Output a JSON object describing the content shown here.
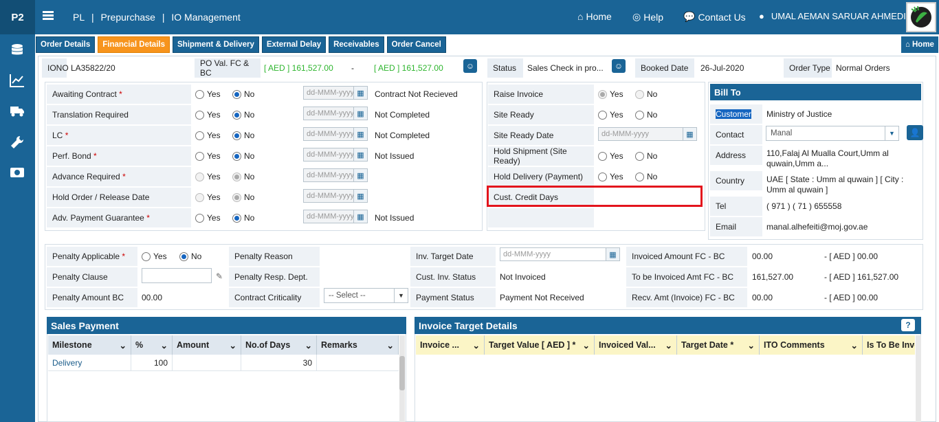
{
  "app": {
    "badge": "P2",
    "breadcrumb": [
      "PL",
      "|",
      "Prepurchase",
      "|",
      "IO Management"
    ],
    "nav": {
      "home": "Home",
      "help": "Help",
      "contact": "Contact Us",
      "user": "UMAL AEMAN SARUAR AHMEDI"
    }
  },
  "tabs": [
    "Order Details",
    "Financial Details",
    "Shipment & Delivery",
    "External Delay",
    "Receivables",
    "Order Cancel"
  ],
  "home_button": "Home",
  "header": {
    "iono_label": "IONO",
    "iono": "LA35822/20",
    "po_label": "PO Val. FC & BC",
    "po_fc": "[ AED ] 161,527.00",
    "dash": "-",
    "po_bc": "[ AED ] 161,527.00",
    "status_label": "Status",
    "status": "Sales Check in pro...",
    "booked_label": "Booked Date",
    "booked": "26-Jul-2020",
    "ordertype_label": "Order Type",
    "ordertype": "Normal Orders"
  },
  "left_rows": [
    {
      "label": "Awaiting Contract",
      "req": "*",
      "yes": "Yes",
      "no": "No",
      "date": "dd-MMM-yyyy",
      "status": "Contract Not Recieved"
    },
    {
      "label": "Translation Required",
      "req": "",
      "yes": "Yes",
      "no": "No",
      "date": "dd-MMM-yyyy",
      "status": "Not Completed"
    },
    {
      "label": "LC",
      "req": "*",
      "yes": "Yes",
      "no": "No",
      "date": "dd-MMM-yyyy",
      "status": "Not Completed"
    },
    {
      "label": "Perf. Bond",
      "req": "*",
      "yes": "Yes",
      "no": "No",
      "date": "dd-MMM-yyyy",
      "status": "Not Issued"
    },
    {
      "label": "Advance Required",
      "req": "*",
      "yes": "Yes",
      "no": "No",
      "date": "dd-MMM-yyyy",
      "status": ""
    },
    {
      "label": "Hold Order / Release Date",
      "req": "",
      "yes": "Yes",
      "no": "No",
      "date": "dd-MMM-yyyy",
      "status": ""
    },
    {
      "label": "Adv. Payment Guarantee",
      "req": "*",
      "yes": "Yes",
      "no": "No",
      "date": "dd-MMM-yyyy",
      "status": "Not Issued"
    }
  ],
  "mid_rows": [
    {
      "label": "Raise Invoice",
      "yes": "Yes",
      "no": "No"
    },
    {
      "label": "Site Ready",
      "yes": "Yes",
      "no": "No"
    },
    {
      "label": "Site Ready Date",
      "date": "dd-MMM-yyyy"
    },
    {
      "label": "Hold Shipment (Site Ready)",
      "yes": "Yes",
      "no": "No"
    },
    {
      "label": "Hold Delivery (Payment)",
      "yes": "Yes",
      "no": "No"
    },
    {
      "label": "Cust. Credit Days"
    }
  ],
  "bill_to": {
    "title": "Bill To",
    "customer_label": "Customer",
    "customer": "Ministry of Justice",
    "contact_label": "Contact",
    "contact": "Manal",
    "address_label": "Address",
    "address": "110,Falaj Al Mualla Court,Umm al quwain,Umm a...",
    "country_label": "Country",
    "country": "UAE [ State : Umm al quwain ] [ City : Umm al quwain ]",
    "tel_label": "Tel",
    "tel": "( 971 ) ( 71 ) 655558",
    "email_label": "Email",
    "email": "manal.alhefeiti@moj.gov.ae"
  },
  "penalty": {
    "applicable_label": "Penalty Applicable",
    "req": "*",
    "yes": "Yes",
    "no": "No",
    "clause_label": "Penalty Clause",
    "amount_label": "Penalty Amount BC",
    "amount": "00.00",
    "reason_label": "Penalty Reason",
    "resp_label": "Penalty Resp. Dept.",
    "crit_label": "Contract Criticality",
    "crit_select": "-- Select --"
  },
  "invoice": {
    "target_label": "Inv. Target Date",
    "target_ph": "dd-MMM-yyyy",
    "cust_status_label": "Cust. Inv. Status",
    "cust_status": "Not Invoiced",
    "pay_label": "Payment Status",
    "pay": "Payment Not Received",
    "invoiced_label": "Invoiced Amount FC - BC",
    "invoiced_fc": "00.00",
    "invoiced_bc": "- [ AED ] 00.00",
    "tobe_label": "To be Invoiced Amt FC - BC",
    "tobe_fc": "161,527.00",
    "tobe_bc": "- [ AED ] 161,527.00",
    "recv_label": "Recv. Amt (Invoice) FC - BC",
    "recv_fc": "00.00",
    "recv_bc": "- [ AED ] 00.00"
  },
  "sales_payment": {
    "title": "Sales Payment",
    "columns": [
      "Milestone",
      "%",
      "Amount",
      "No.of Days",
      "Remarks"
    ],
    "rows": [
      [
        "Delivery",
        "100",
        "",
        "30",
        ""
      ]
    ]
  },
  "invoice_target": {
    "title": "Invoice Target Details",
    "columns": [
      "Invoice ...",
      "Target Value [ AED ] *",
      "Invoiced Val...",
      "Target Date *",
      "ITO Comments",
      "Is To Be Invo"
    ]
  }
}
